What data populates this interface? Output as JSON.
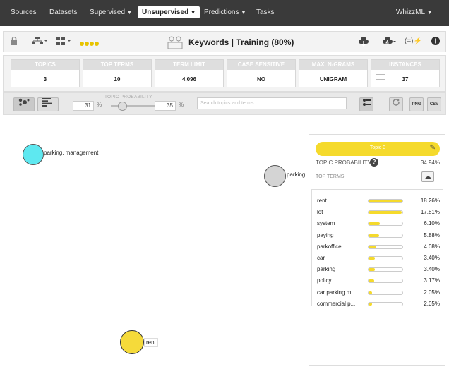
{
  "nav": {
    "items": [
      {
        "label": "Sources"
      },
      {
        "label": "Datasets"
      },
      {
        "label": "Supervised"
      },
      {
        "label": "Unsupervised"
      },
      {
        "label": "Predictions"
      },
      {
        "label": "Tasks"
      }
    ],
    "user": "WhizzML"
  },
  "titlebar": {
    "title": "Keywords | Training (80%)"
  },
  "summary": [
    {
      "label": "TOPICS",
      "value": "3"
    },
    {
      "label": "TOP TERMS",
      "value": "10"
    },
    {
      "label": "TERM LIMIT",
      "value": "4,096"
    },
    {
      "label": "CASE SENSITIVE",
      "value": "NO"
    },
    {
      "label": "MAX. N-GRAMS",
      "value": "UNIGRAM"
    },
    {
      "label": "INSTANCES",
      "value": "37"
    }
  ],
  "toolbar": {
    "prob_label": "TOPIC PROBABILITY",
    "min_value": "31",
    "max_value": "35",
    "pct": "%",
    "search_placeholder": "Search topics and terms",
    "png": "PNG",
    "csv": "CSV"
  },
  "map": {
    "topics": [
      {
        "label": "parking, management",
        "color": "#5ee8f0"
      },
      {
        "label": "parking",
        "color": "#d4d4d4"
      },
      {
        "label": "rent",
        "color": "#f5da3a"
      }
    ]
  },
  "panel": {
    "topic_name": "Topic 3",
    "topic_color": "#f5da2c",
    "prob_label": "TOPIC PROBABILITY",
    "prob_value": "34.94%",
    "top_terms_label": "TOP TERMS",
    "terms": [
      {
        "term": "rent",
        "value": "18.26%",
        "pct": 18.26
      },
      {
        "term": "lot",
        "value": "17.81%",
        "pct": 17.81
      },
      {
        "term": "system",
        "value": "6.10%",
        "pct": 6.1
      },
      {
        "term": "paying",
        "value": "5.88%",
        "pct": 5.88
      },
      {
        "term": "parkoffice",
        "value": "4.08%",
        "pct": 4.08
      },
      {
        "term": "car",
        "value": "3.40%",
        "pct": 3.4
      },
      {
        "term": "parking",
        "value": "3.40%",
        "pct": 3.4
      },
      {
        "term": "policy",
        "value": "3.17%",
        "pct": 3.17
      },
      {
        "term": "car parking m...",
        "value": "2.05%",
        "pct": 2.05
      },
      {
        "term": "commercial p...",
        "value": "2.05%",
        "pct": 2.05
      }
    ]
  }
}
